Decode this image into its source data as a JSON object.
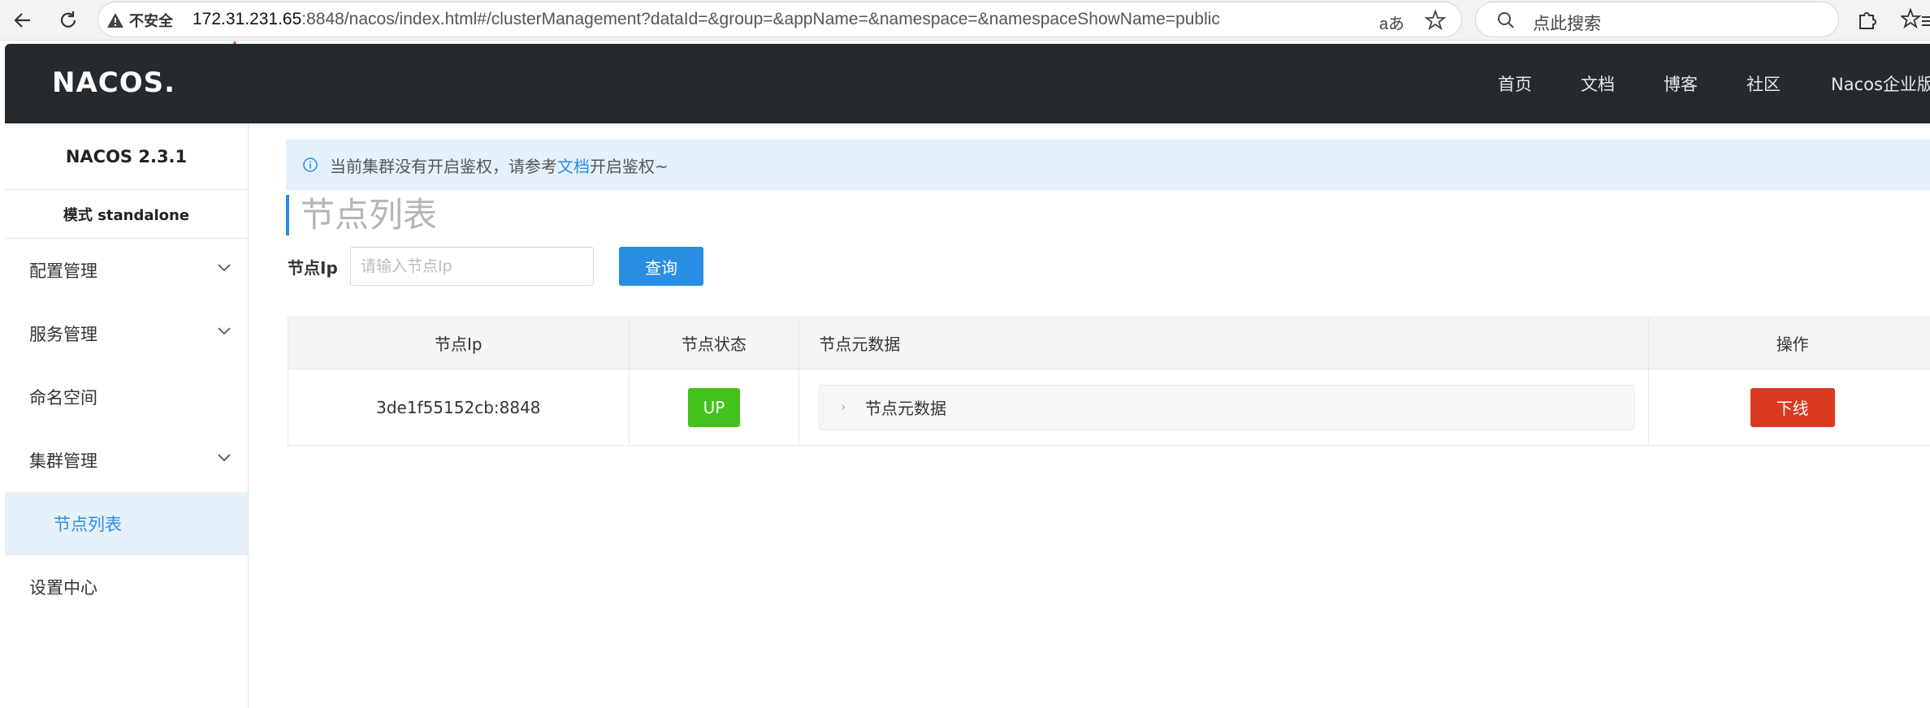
{
  "browser": {
    "security_label": "不安全",
    "url_host": "172.31.231.65",
    "url_rest": ":8848/nacos/index.html#/clusterManagement?dataId=&group=&appName=&namespace=&namespaceShowName=public",
    "read_aloud": "aあ",
    "search_placeholder": "点此搜索"
  },
  "header": {
    "logo": {
      "part1": "NA",
      "part2": "C",
      "part3": "OS",
      "dot": "."
    },
    "nav": [
      "首页",
      "文档",
      "博客",
      "社区",
      "Nacos企业版"
    ]
  },
  "sidebar": {
    "version": "NACOS 2.3.1",
    "mode": "模式 standalone",
    "items": [
      {
        "label": "配置管理",
        "expandable": true
      },
      {
        "label": "服务管理",
        "expandable": true
      },
      {
        "label": "命名空间",
        "expandable": false
      },
      {
        "label": "集群管理",
        "expandable": true
      },
      {
        "label": "节点列表",
        "active": true
      },
      {
        "label": "设置中心",
        "expandable": false
      }
    ]
  },
  "main": {
    "notice": {
      "prefix": "当前集群没有开启鉴权，请参考",
      "link": "文档",
      "suffix": "开启鉴权~"
    },
    "title": "节点列表",
    "filter": {
      "label": "节点Ip",
      "placeholder": "请输入节点Ip",
      "button": "查询"
    },
    "table": {
      "headers": [
        "节点Ip",
        "节点状态",
        "节点元数据",
        "操作"
      ],
      "rows": [
        {
          "ip": "3de1f55152cb:8848",
          "status": "UP",
          "meta": "节点元数据",
          "action": "下线"
        }
      ]
    }
  },
  "colors": {
    "accent": "#2a8de4",
    "header_bg": "#252a2f",
    "up": "#43c11c",
    "danger": "#d9391f"
  }
}
